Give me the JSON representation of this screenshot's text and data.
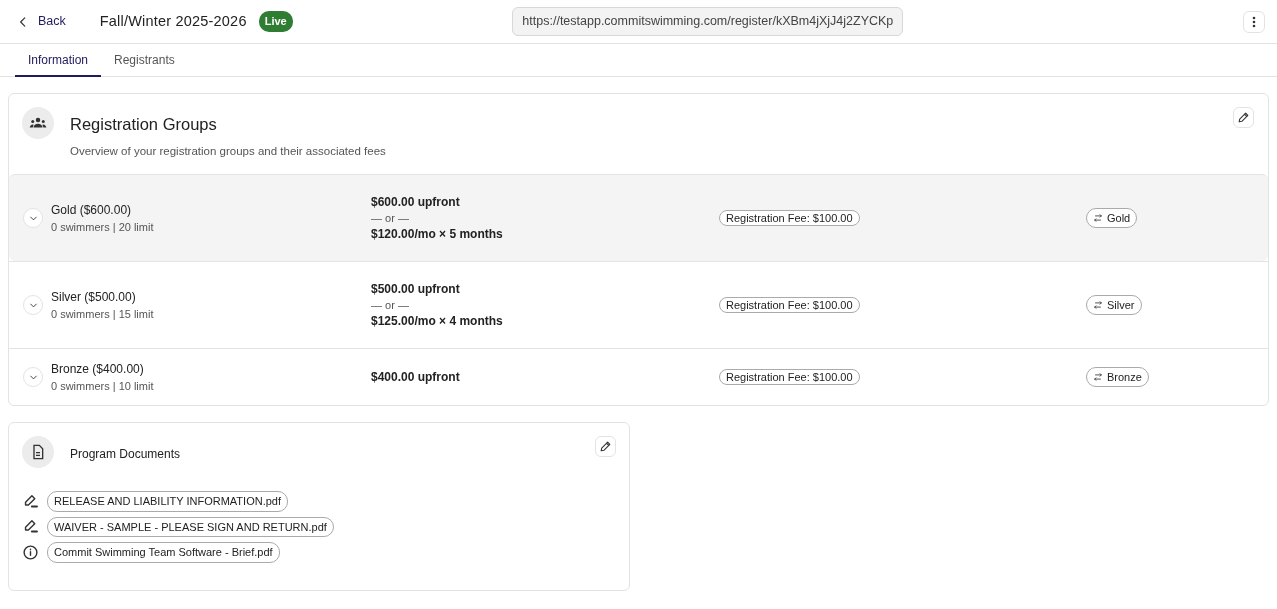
{
  "header": {
    "back": "Back",
    "title": "Fall/Winter 2025-2026",
    "status": "Live",
    "url": "https://testapp.commitswimming.com/register/kXBm4jXjJ4j2ZYCKp"
  },
  "tabs": [
    {
      "label": "Information",
      "selected": true
    },
    {
      "label": "Registrants",
      "selected": false
    }
  ],
  "registration_groups": {
    "title": "Registration Groups",
    "subtitle": "Overview of your registration groups and their associated fees",
    "groups": [
      {
        "name": "Gold",
        "price": "($600.00)",
        "stats": "0 swimmers | 20 limit",
        "upfront": "$600.00 upfront",
        "separator": "— or —",
        "installments": "$120.00/mo × 5 months",
        "fee": "Registration Fee: $100.00",
        "tag": "Gold",
        "selected": true
      },
      {
        "name": "Silver",
        "price": "($500.00)",
        "stats": "0 swimmers | 15 limit",
        "upfront": "$500.00 upfront",
        "separator": "— or —",
        "installments": "$125.00/mo × 4 months",
        "fee": "Registration Fee: $100.00",
        "tag": "Silver",
        "selected": false
      },
      {
        "name": "Bronze",
        "price": "($400.00)",
        "stats": "0 swimmers | 10 limit",
        "upfront": "$400.00 upfront",
        "fee": "Registration Fee: $100.00",
        "tag": "Bronze",
        "selected": false
      }
    ]
  },
  "program_documents": {
    "title": "Program Documents",
    "documents": [
      {
        "kind": "sign",
        "name": "RELEASE AND LIABILITY INFORMATION.pdf"
      },
      {
        "kind": "sign",
        "name": "WAIVER - SAMPLE - PLEASE SIGN AND RETURN.pdf"
      },
      {
        "kind": "info",
        "name": "Commit Swimming Team Software - Brief.pdf"
      }
    ]
  }
}
